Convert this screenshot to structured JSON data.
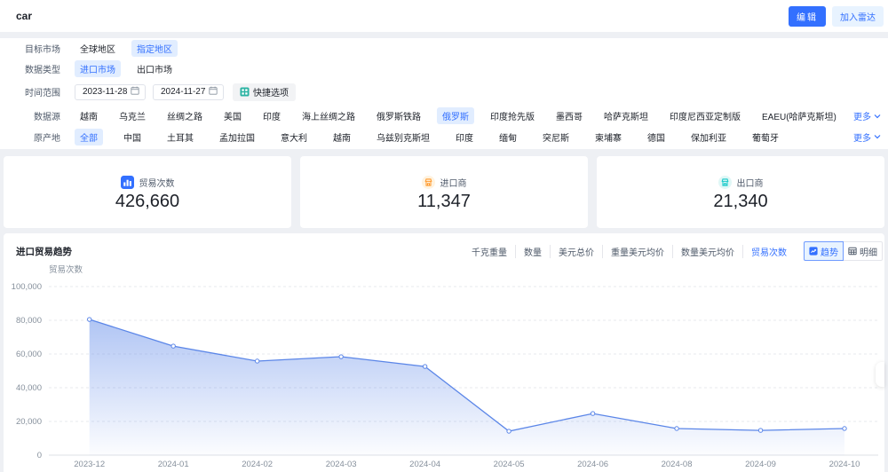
{
  "topbar": {
    "query": "car",
    "edit": "编辑",
    "radar": "加入雷达"
  },
  "filters": {
    "target_market": {
      "label": "目标市场",
      "items": [
        {
          "label": "全球地区"
        },
        {
          "label": "指定地区",
          "selected": true
        }
      ]
    },
    "data_type": {
      "label": "数据类型",
      "items": [
        {
          "label": "进口市场",
          "selected": true
        },
        {
          "label": "出口市场"
        }
      ]
    },
    "time_range": {
      "label": "时间范围",
      "start": "2023-11-28",
      "end": "2024-11-27",
      "quick": "快捷选项"
    },
    "data_source": {
      "label": "数据源",
      "more": "更多",
      "items": [
        {
          "label": "越南"
        },
        {
          "label": "乌克兰"
        },
        {
          "label": "丝绸之路"
        },
        {
          "label": "美国"
        },
        {
          "label": "印度"
        },
        {
          "label": "海上丝绸之路"
        },
        {
          "label": "俄罗斯铁路"
        },
        {
          "label": "俄罗斯",
          "selected": true
        },
        {
          "label": "印度抢先版"
        },
        {
          "label": "墨西哥"
        },
        {
          "label": "哈萨克斯坦"
        },
        {
          "label": "印度尼西亚定制版"
        },
        {
          "label": "EAEU(哈萨克斯坦)"
        }
      ]
    },
    "origin": {
      "label": "原产地",
      "more": "更多",
      "items": [
        {
          "label": "全部",
          "selected": true
        },
        {
          "label": "中国"
        },
        {
          "label": "土耳其"
        },
        {
          "label": "孟加拉国"
        },
        {
          "label": "意大利"
        },
        {
          "label": "越南"
        },
        {
          "label": "乌兹别克斯坦"
        },
        {
          "label": "印度"
        },
        {
          "label": "缅甸"
        },
        {
          "label": "突尼斯"
        },
        {
          "label": "柬埔寨"
        },
        {
          "label": "德国"
        },
        {
          "label": "保加利亚"
        },
        {
          "label": "葡萄牙"
        }
      ]
    }
  },
  "stats": [
    {
      "label": "贸易次数",
      "value": "426,660",
      "icon": "bar-chart-icon",
      "color": "#3370ff"
    },
    {
      "label": "进口商",
      "value": "11,347",
      "icon": "importer-icon",
      "color": "#ff9a2e"
    },
    {
      "label": "出口商",
      "value": "21,340",
      "icon": "exporter-icon",
      "color": "#14c9c9"
    }
  ],
  "trend": {
    "title": "进口贸易趋势",
    "metrics": [
      {
        "label": "千克重量"
      },
      {
        "label": "数量"
      },
      {
        "label": "美元总价"
      },
      {
        "label": "重量美元均价"
      },
      {
        "label": "数量美元均价"
      },
      {
        "label": "贸易次数",
        "selected": true
      }
    ],
    "view_trend": "趋势",
    "view_detail": "明细"
  },
  "chart_data": {
    "type": "area",
    "title": "进口贸易趋势",
    "ylabel": "贸易次数",
    "ylim": [
      0,
      100000
    ],
    "y_ticks": [
      0,
      20000,
      40000,
      60000,
      80000,
      100000
    ],
    "categories": [
      "2023-12",
      "2024-01",
      "2024-02",
      "2024-03",
      "2024-04",
      "2024-05",
      "2024-06",
      "2024-08",
      "2024-09",
      "2024-10"
    ],
    "values": [
      80500,
      64700,
      55800,
      58400,
      52600,
      14200,
      24700,
      15800,
      14700,
      15800
    ],
    "line_color": "#5b86e8",
    "grid": true,
    "legend": "none"
  }
}
